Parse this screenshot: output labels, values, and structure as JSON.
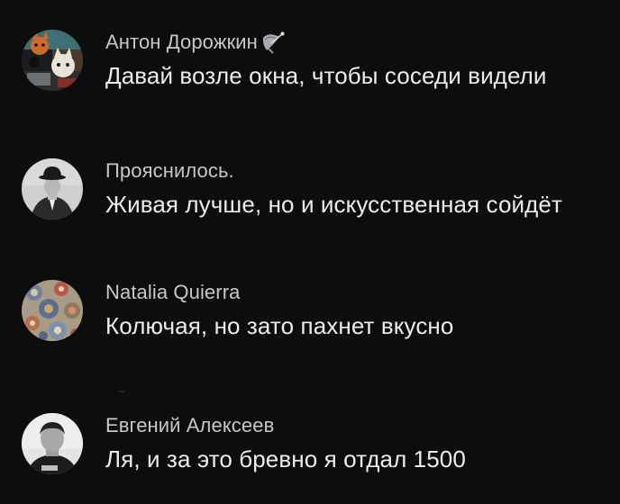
{
  "comments": [
    {
      "author": "Антон Дорожкин",
      "text": "Давай возле окна, чтобы соседи видели",
      "avatar_icon": "cat-collage-avatar",
      "badge_icon": "satellite-dish-icon"
    },
    {
      "author": "Прояснилось.",
      "text": "Живая лучше, но и искусственная сойдёт",
      "avatar_icon": "bowler-hat-man-avatar"
    },
    {
      "author": "Natalia Quierra",
      "text": "Колючая, но зато пахнет вкусно",
      "avatar_icon": "paisley-pattern-avatar"
    },
    {
      "author": "Евгений Алексеев",
      "text": "Ля, и за это бревно я отдал 1500",
      "avatar_icon": "man-portrait-avatar"
    }
  ],
  "colors": {
    "background": "#0d0d0e",
    "author": "#c6c7cb",
    "text": "#ececee"
  }
}
